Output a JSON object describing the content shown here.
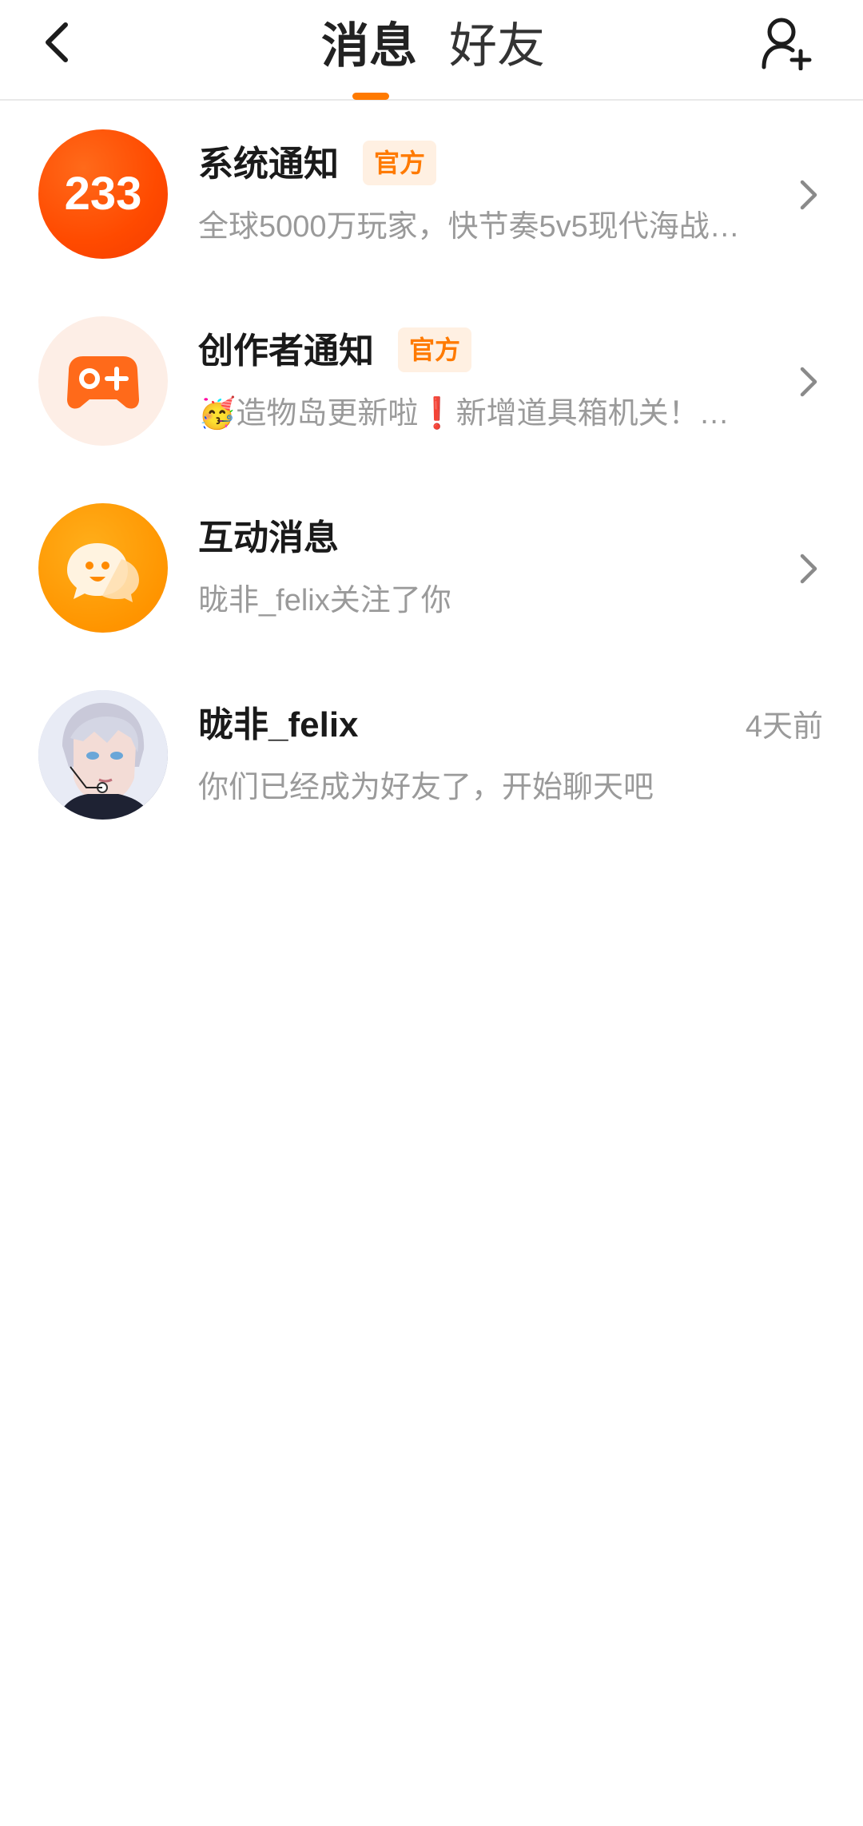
{
  "header": {
    "tabs": [
      {
        "label": "消息",
        "active": true
      },
      {
        "label": "好友",
        "active": false
      }
    ],
    "accent_color": "#ff7a00"
  },
  "conversations": [
    {
      "title": "系统通知",
      "badge": "官方",
      "preview": "全球5000万玩家，快节奏5v5现代海战…",
      "avatar": "logo-233-icon",
      "avatar_text": "233",
      "trailing": "chevron-right-icon"
    },
    {
      "title": "创作者通知",
      "badge": "官方",
      "preview_emoji": "🥳",
      "preview": "造物岛更新啦❗新增道具箱机关！…",
      "avatar": "gamepad-plus-icon",
      "trailing": "chevron-right-icon"
    },
    {
      "title": "互动消息",
      "preview": "昽非_felix关注了你",
      "avatar": "chat-bubble-face-icon",
      "trailing": "chevron-right-icon"
    },
    {
      "title": "昽非_felix",
      "preview": "你们已经成为好友了，开始聊天吧",
      "time": "4天前",
      "avatar": "user-avatar-photo"
    }
  ]
}
